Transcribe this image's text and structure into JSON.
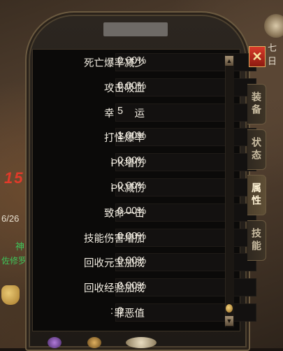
{
  "left_hud": {
    "number": "15",
    "fraction": "6/26",
    "green_text_1": "神",
    "green_text_2": "佐修罗"
  },
  "top_right": {
    "text": "七日"
  },
  "panel": {
    "close_label": "✕",
    "tabs": [
      {
        "label": "装备",
        "active": false
      },
      {
        "label": "状态",
        "active": false
      },
      {
        "label": "属性",
        "active": true
      },
      {
        "label": "技能",
        "active": false
      }
    ],
    "stats": [
      {
        "label": "死亡爆率减少",
        "value": "0.00%"
      },
      {
        "label": "攻击吸血",
        "value": "0.00%"
      },
      {
        "label": "幸　　运",
        "value": "5"
      },
      {
        "label": "打怪爆率",
        "value": "1.00%"
      },
      {
        "label": "PK增伤",
        "value": "0.00%"
      },
      {
        "label": "PK减伤",
        "value": "0.00%"
      },
      {
        "label": "致命一击",
        "value": "0.00%"
      },
      {
        "label": "技能伤害增加",
        "value": "0.00%"
      },
      {
        "label": "回收元宝加成",
        "value": "0.00%"
      },
      {
        "label": "回收经验加成",
        "value": "0.00%"
      },
      {
        "label": "罪恶值",
        "value": "0"
      }
    ],
    "separator": ":",
    "scroll_up": "▲",
    "scroll_down": "▼"
  },
  "colors": {
    "text": "#f2ede2",
    "close": "#d83a2a",
    "frame": "#6b5a40"
  }
}
